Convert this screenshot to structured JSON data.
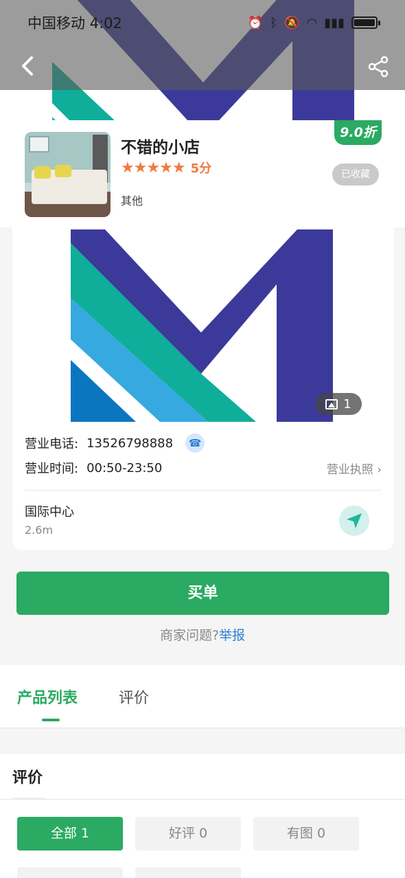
{
  "status_bar": {
    "carrier_time": "中国移动 4:02",
    "icons": [
      "alarm-icon",
      "bluetooth-icon",
      "mute-icon",
      "wifi-icon",
      "4g-signal-icon",
      "battery-icon"
    ]
  },
  "store": {
    "name": "不错的小店",
    "score": "5分",
    "stars": "★★★★★",
    "category": "其他",
    "discount": "9.0折",
    "favorite_label": "已收藏"
  },
  "gallery": {
    "photo_count": "1"
  },
  "info": {
    "phone_label": "营业电话:",
    "phone": "13526798888",
    "hours_label": "营业时间:",
    "hours": "00:50-23:50",
    "license_label": "营业执照",
    "address": "国际中心",
    "distance": "2.6m"
  },
  "actions": {
    "pay_label": "买单",
    "report_prefix": "商家问题?",
    "report_link": "举报"
  },
  "tabs": [
    {
      "label": "产品列表",
      "active": true
    },
    {
      "label": "评价",
      "active": false
    }
  ],
  "reviews": {
    "title": "评价",
    "filters": [
      {
        "label": "全部  1",
        "active": true
      },
      {
        "label": "好评 0",
        "active": false
      },
      {
        "label": "有图 0",
        "active": false
      }
    ]
  },
  "colors": {
    "accent": "#2aaa62",
    "rating": "#f07a3f",
    "link": "#2d7fd2"
  }
}
